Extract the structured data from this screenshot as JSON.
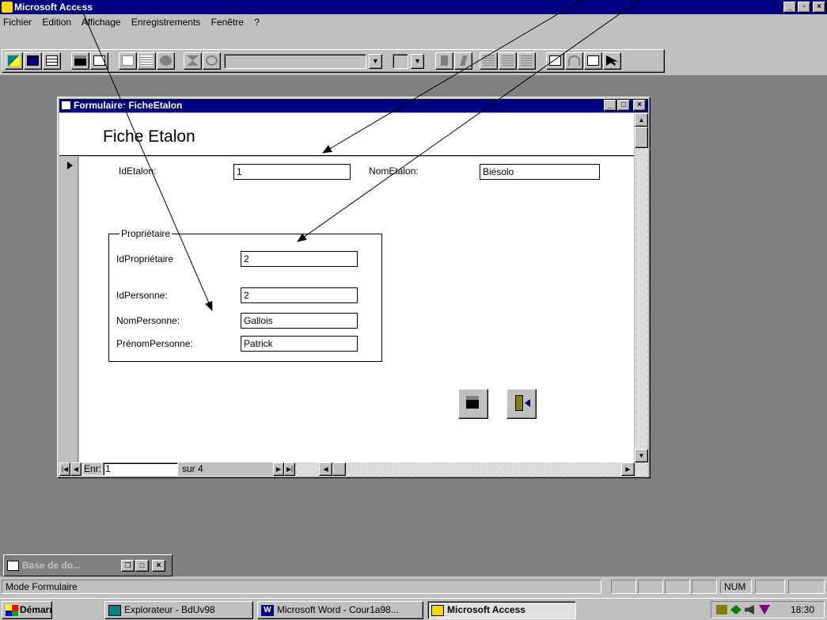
{
  "app": {
    "title": "Microsoft Access"
  },
  "menu": [
    "Fichier",
    "Edition",
    "Affichage",
    "Enregistrements",
    "Fenêtre",
    "?"
  ],
  "form": {
    "window_title": "Formulaire: FicheEtalon",
    "heading": "Fiche Etalon",
    "id_label": "IdEtalon:",
    "id_value": "1",
    "name_label": "NomEtalon:",
    "name_value": "Biésolo",
    "group_label": "Propriétaire",
    "owner_label": "IdPropriétaire",
    "owner_value": "2",
    "person_id_label": "IdPersonne:",
    "person_id_value": "2",
    "person_name_label": "NomPersonne:",
    "person_name_value": "Gallois",
    "person_first_label": "PrénomPersonne:",
    "person_first_value": "Patrick"
  },
  "nav": {
    "record_label": "Enr:",
    "record_value": "1",
    "of_label": "sur  4"
  },
  "minimized": {
    "title": "Base de do..."
  },
  "status": {
    "mode": "Mode Formulaire",
    "num": "NUM"
  },
  "taskbar": {
    "start": "Démarrer",
    "items": [
      "Explorateur - BdUv98",
      "Microsoft Word - Cour1a98...",
      "Microsoft Access"
    ],
    "clock": "18:30"
  }
}
